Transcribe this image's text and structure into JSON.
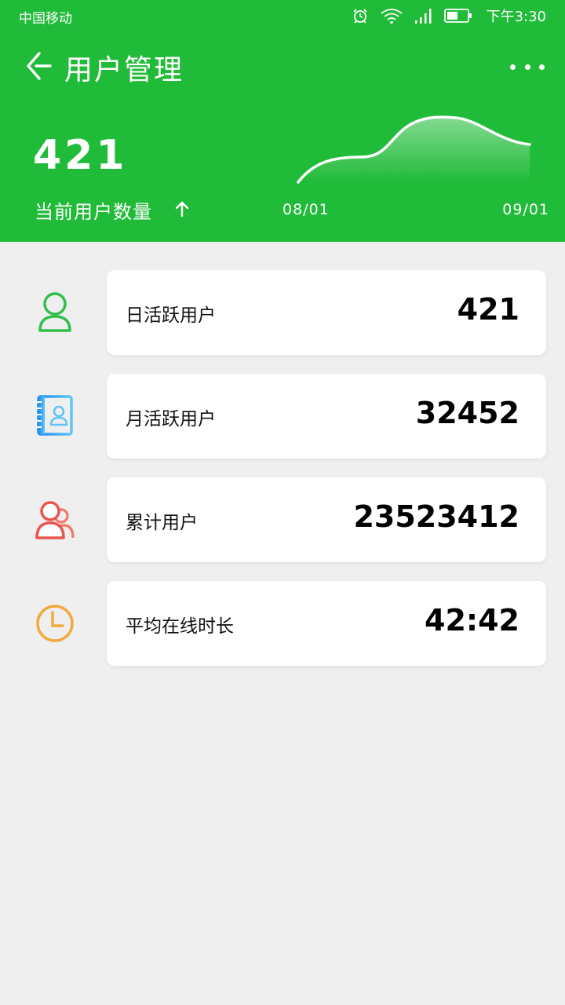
{
  "status": {
    "carrier": "中国移动",
    "time": "下午3:30",
    "icons": [
      "alarm-icon",
      "wifi-icon",
      "signal-icon",
      "battery-icon"
    ]
  },
  "header": {
    "title": "用户管理",
    "current_count": "421",
    "current_label": "当前用户数量",
    "date_start": "08/01",
    "date_end": "09/01",
    "colors": {
      "background": "#20bb38",
      "text": "#ffffff"
    }
  },
  "stats": [
    {
      "label": "日活跃用户",
      "value": "421",
      "icon": "user-icon",
      "color": "#2fbf4a"
    },
    {
      "label": "月活跃用户",
      "value": "32452",
      "icon": "contact-book-icon",
      "color": "#2a9df4"
    },
    {
      "label": "累计用户",
      "value": "23523412",
      "icon": "user-group-icon",
      "color": "#ec5f56"
    },
    {
      "label": "平均在线时长",
      "value": "42:42",
      "icon": "clock-icon",
      "color": "#f4a93b"
    }
  ]
}
